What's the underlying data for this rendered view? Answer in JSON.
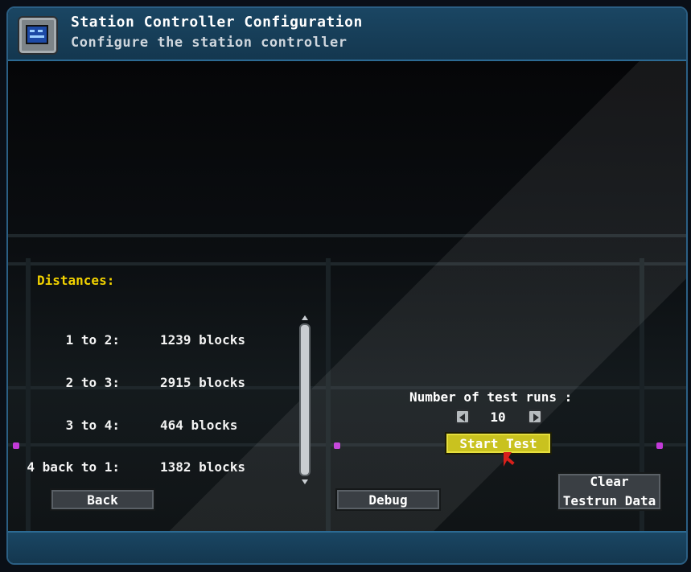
{
  "window": {
    "title": "Station Controller Configuration",
    "subtitle": "Configure the station controller",
    "icon": "monitor-panel-icon"
  },
  "distances": {
    "label": "Distances:",
    "rows": [
      {
        "name": "1 to 2:",
        "value": "1239 blocks"
      },
      {
        "name": "2 to 3:",
        "value": "2915 blocks"
      },
      {
        "name": "3 to 4:",
        "value": "464 blocks"
      },
      {
        "name": "4 back to 1:",
        "value": "1382 blocks"
      }
    ]
  },
  "test_runs": {
    "label": "Number of test runs :",
    "value": "10",
    "start_label": "Start Test"
  },
  "buttons": {
    "back": "Back",
    "debug": "Debug",
    "clear_line1": "Clear",
    "clear_line2": "Testrun Data"
  },
  "colors": {
    "accent": "#f2d200",
    "start_button": "#c9c21f",
    "frame": "#1a4663"
  }
}
